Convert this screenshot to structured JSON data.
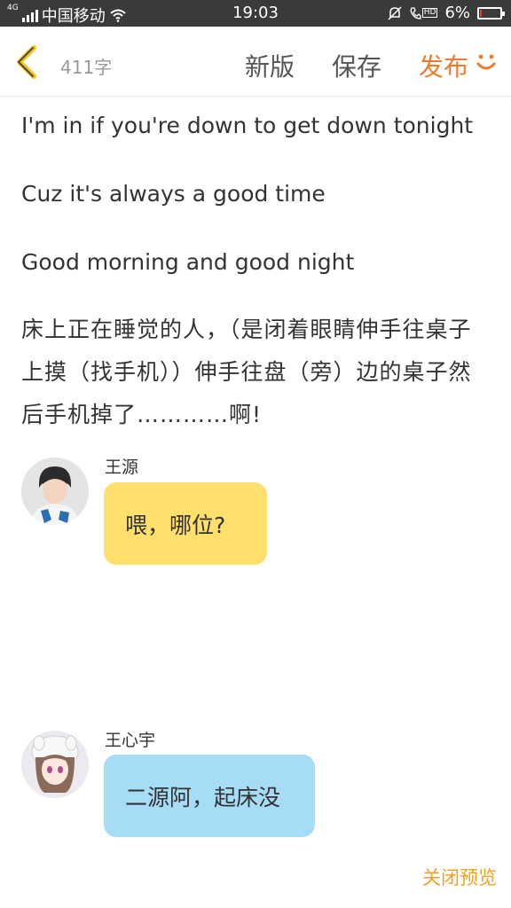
{
  "status_bar": {
    "network": "4G",
    "carrier": "中国移动",
    "time": "19:03",
    "hd_label": "HD",
    "battery_text": "6%",
    "battery_level_percent": 6,
    "battery_color": "#e23a2a"
  },
  "header": {
    "word_count": "411字",
    "new_version_label": "新版",
    "save_label": "保存",
    "publish_label": "发布",
    "accent_color": "#f07a2a"
  },
  "story": {
    "paragraphs": [
      "I'm in if you're down to get down tonight",
      "Cuz it's always a good time",
      "Good morning and good night",
      "床上正在睡觉的人，（是闭着眼睛伸手往桌子上摸（找手机））伸手往盘（旁）边的桌子然后手机掉了…………啊!"
    ]
  },
  "chat": [
    {
      "name": "王源",
      "message": "喂，哪位?",
      "bubble_color": "#ffdf6e",
      "avatar_icon": "boy-avatar-icon"
    },
    {
      "name": "王心宇",
      "message": "二源阿，起床没",
      "bubble_color": "#a7dcf7",
      "avatar_icon": "anime-girl-avatar-icon"
    }
  ],
  "footer": {
    "close_preview_label": "关闭预览"
  }
}
